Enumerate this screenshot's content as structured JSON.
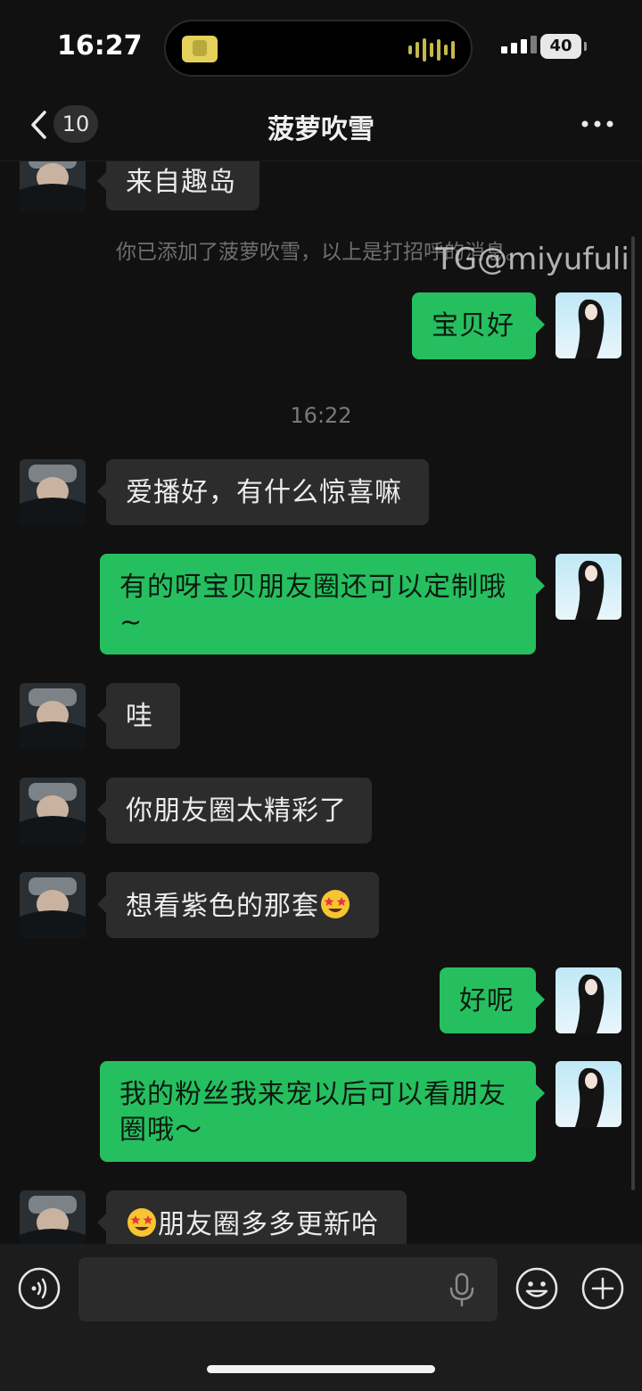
{
  "status": {
    "time": "16:27",
    "battery": "40"
  },
  "header": {
    "back_count": "10",
    "title": "菠萝吹雪"
  },
  "watermark": "TG@miyufuli",
  "messages": {
    "m0": "来自趣岛",
    "sys": "你已添加了菠萝吹雪，以上是打招呼的消息。",
    "m1": "宝贝好",
    "time_divider": "16:22",
    "m2": "爱播好，有什么惊喜嘛",
    "m3_line1": "有的呀宝贝朋友圈还可以定制哦",
    "m3_line2": "~",
    "m4": "哇",
    "m5": "你朋友圈太精彩了",
    "m6": "想看紫色的那套",
    "m7": "好呢",
    "m8_line1": "我的粉丝我来宠以后可以看朋友",
    "m8_line2": "圈哦～",
    "m9": "朋友圈多多更新哈"
  },
  "input": {
    "placeholder": ""
  },
  "colors": {
    "background": "#111111",
    "outgoing": "#26bf60",
    "incoming": "#2c2c2c"
  },
  "icons": [
    "back-chevron-icon",
    "more-icon",
    "voice-icon",
    "microphone-icon",
    "emoji-icon",
    "plus-icon",
    "star-struck-emoji-icon"
  ]
}
